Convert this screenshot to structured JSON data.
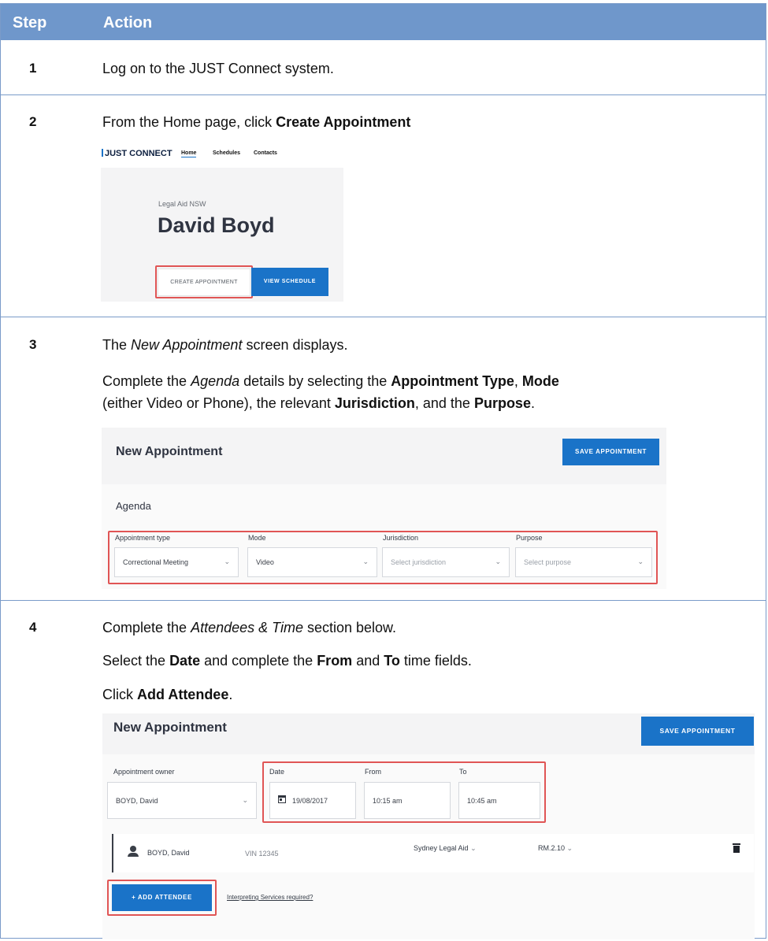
{
  "table": {
    "headers": {
      "step": "Step",
      "action": "Action"
    },
    "steps": [
      {
        "num": "1",
        "t1": "Log on to the JUST Connect system."
      },
      {
        "num": "2",
        "t1": "From the Home page, click ",
        "b1": "Create Appointment"
      },
      {
        "num": "3",
        "l1a": "The ",
        "l1i": "New Appointment",
        "l1b": " screen displays.",
        "p2a": "Complete the ",
        "p2i": "Agenda",
        "p2b": " details by selecting the ",
        "p2c": "Appointment Type",
        "p2d": ", ",
        "p2e": "Mode",
        "p2f": " (either Video or Phone), the relevant ",
        "p2g": "Jurisdiction",
        "p2h": ", and the ",
        "p2j": "Purpose",
        "p2k": "."
      },
      {
        "num": "4",
        "l1a": "Complete the ",
        "l1i": "Attendees & Time",
        "l1b": " section below.",
        "l2a": "Select the ",
        "l2b": "Date",
        "l2c": " and complete the ",
        "l2d": "From",
        "l2e": " and ",
        "l2f": "To",
        "l2g": " time fields.",
        "l3a": "Click ",
        "l3b": "Add Attendee",
        "l3c": "."
      }
    ]
  },
  "screen_home": {
    "logo": "JUST CONNECT",
    "nav": [
      "Home",
      "Schedules",
      "Contacts"
    ],
    "org": "Legal Aid NSW",
    "user": "David Boyd",
    "create_btn": "CREATE APPOINTMENT",
    "view_btn": "VIEW SCHEDULE"
  },
  "screen_agenda": {
    "title": "New Appointment",
    "save_btn": "SAVE APPOINTMENT",
    "section": "Agenda",
    "fields": [
      {
        "label": "Appointment type",
        "value": "Correctional Meeting"
      },
      {
        "label": "Mode",
        "value": "Video"
      },
      {
        "label": "Jurisdiction",
        "value": "Select jurisdiction"
      },
      {
        "label": "Purpose",
        "value": "Select purpose"
      }
    ]
  },
  "screen_attendees": {
    "title": "New Appointment",
    "save_btn": "SAVE APPOINTMENT",
    "owner_label": "Appointment owner",
    "owner_value": "BOYD, David",
    "date_label": "Date",
    "date_value": "19/08/2017",
    "from_label": "From",
    "from_value": "10:15 am",
    "to_label": "To",
    "to_value": "10:45 am",
    "attendee_name": "BOYD, David",
    "attendee_vin": "VIN 12345",
    "attendee_location": "Sydney Legal Aid",
    "attendee_room": "RM.2.10",
    "add_btn": "+ ADD ATTENDEE",
    "interp_link": "Interpreting Services required?"
  }
}
